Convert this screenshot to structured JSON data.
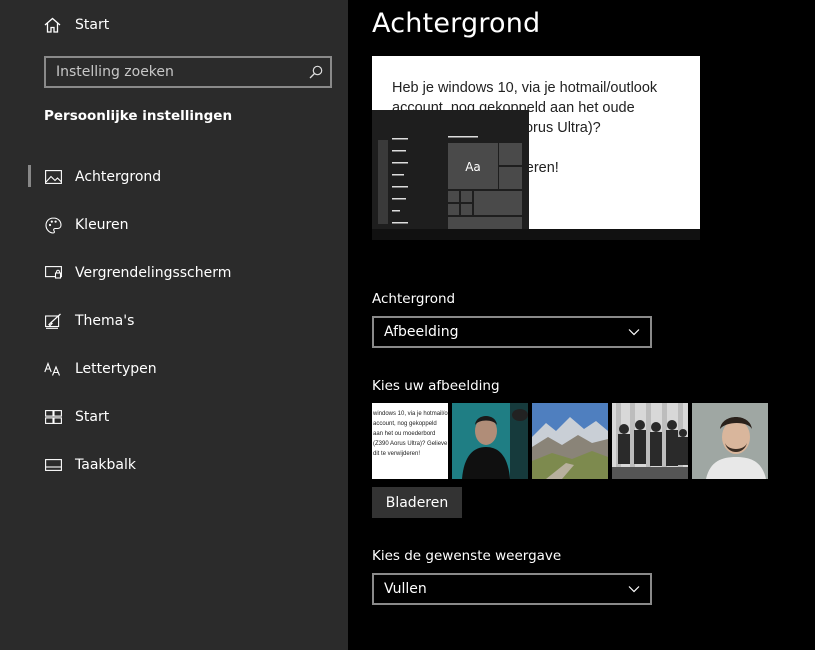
{
  "sidebar": {
    "home_label": "Start",
    "search_placeholder": "Instelling zoeken",
    "section_title": "Persoonlijke instellingen",
    "items": [
      {
        "label": "Achtergrond",
        "icon": "picture-icon",
        "active": true
      },
      {
        "label": "Kleuren",
        "icon": "palette-icon"
      },
      {
        "label": "Vergrendelingsscherm",
        "icon": "lock-screen-icon"
      },
      {
        "label": "Thema's",
        "icon": "theme-brush-icon"
      },
      {
        "label": "Lettertypen",
        "icon": "font-icon"
      },
      {
        "label": "Start",
        "icon": "start-tiles-icon"
      },
      {
        "label": "Taakbalk",
        "icon": "taskbar-icon"
      }
    ]
  },
  "main": {
    "title": "Achtergrond",
    "preview": {
      "line1": "Heb je windows 10, via je hotmail/outlook account, nog gekoppeld aan het oude moederbord (Z390 Aorus Ultra)?",
      "line2": "Gelieve dit te verwijderen!",
      "sample_text": "Aa"
    },
    "background_label": "Achtergrond",
    "background_value": "Afbeelding",
    "choose_label": "Kies uw afbeelding",
    "thumb1_text": "windows 10, via je hotmail/o account, nog gekoppeld aan het ou moederbord (Z390 Aorus Ultra)? Gelieve dit te verwijderen!",
    "browse_label": "Bladeren",
    "fit_label": "Kies de gewenste weergave",
    "fit_value": "Vullen"
  }
}
